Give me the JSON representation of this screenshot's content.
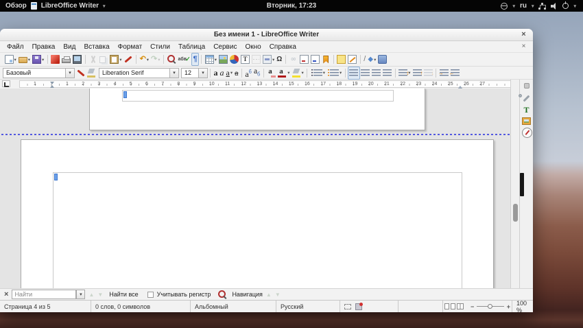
{
  "topbar": {
    "activities_label": "Обзор",
    "app_name": "LibreOffice Writer",
    "clock": "Вторник, 17:23",
    "keyboard_layout": "ru"
  },
  "window": {
    "title": "Без имени 1 - LibreOffice Writer"
  },
  "menubar": {
    "items": [
      "Файл",
      "Правка",
      "Вид",
      "Вставка",
      "Формат",
      "Стили",
      "Таблица",
      "Сервис",
      "Окно",
      "Справка"
    ]
  },
  "toolbar2": {
    "paragraph_style": "Базовый",
    "font_name": "Liberation Serif",
    "font_size": "12"
  },
  "ruler": {
    "pre_margin_number": "1",
    "numbers": [
      "1",
      "2",
      "3",
      "4",
      "5",
      "6",
      "7",
      "8",
      "9",
      "10",
      "11",
      "12",
      "13",
      "14",
      "15",
      "16",
      "17",
      "18",
      "19",
      "20",
      "21",
      "22",
      "23",
      "24",
      "25",
      "26",
      "27"
    ]
  },
  "find_bar": {
    "placeholder": "Найти",
    "find_all_label": "Найти все",
    "match_case_label": "Учитывать регистр",
    "navigation_label": "Навигация"
  },
  "statusbar": {
    "page_info": "Страница 4 из 5",
    "word_count": "0 слов, 0 символов",
    "page_style": "Альбомный",
    "language": "Русский",
    "zoom_level": "100 %",
    "zoom_minus": "−",
    "zoom_plus": "+"
  },
  "colors": {
    "accent_blue": "#3f79d0",
    "page_break_line": "#5358e0",
    "bookmark_orange": "#e08818",
    "pdf_red": "#c02818"
  },
  "glyphs": {
    "dropdown": "▾",
    "close": "×",
    "undo": "↶",
    "redo": "↷",
    "omega": "Ω",
    "pilcrow": "¶",
    "letter": "а",
    "sup_b": "б",
    "diamond": "◆",
    "slash": "/",
    "chain": "∞",
    "letter_T": "T",
    "abc": "абв",
    "check": "✓",
    "up": "▲",
    "down": "▼",
    "updown": "↕",
    "up_s": "↑",
    "down_s": "↓",
    "right_s": "→",
    "left_s": "←"
  }
}
